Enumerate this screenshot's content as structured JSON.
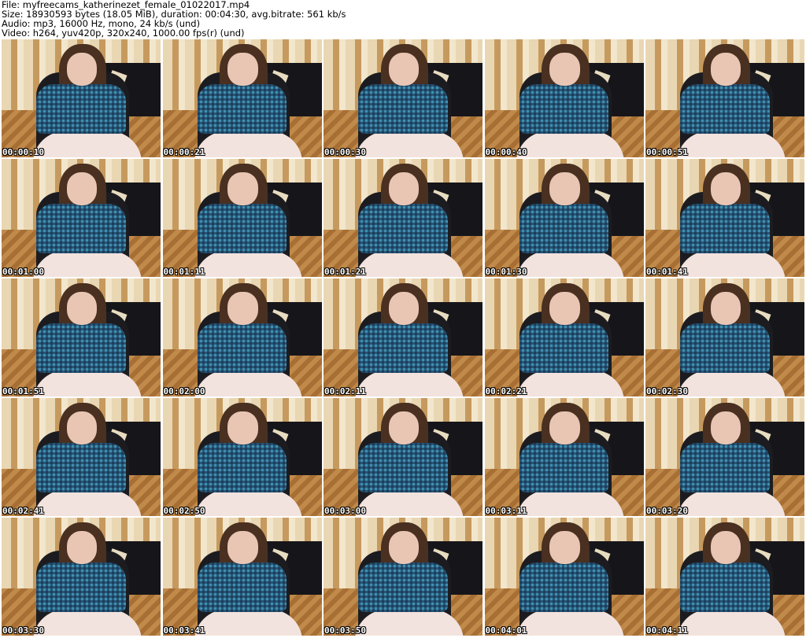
{
  "header": {
    "file_line": "File: myfreecams_katherinezet_female_01022017.mp4",
    "size_line": "Size: 18930593 bytes (18.05 MiB), duration: 00:04:30, avg.bitrate: 561 kb/s",
    "audio_line": "Audio: mp3, 16000 Hz, mono, 24 kb/s (und)",
    "video_line": "Video: h264, yuv420p, 320x240, 1000.00 fps(r) (und)"
  },
  "thumbnails": [
    "00:00:10",
    "00:00:21",
    "00:00:30",
    "00:00:40",
    "00:00:51",
    "00:01:00",
    "00:01:11",
    "00:01:21",
    "00:01:30",
    "00:01:41",
    "00:01:51",
    "00:02:00",
    "00:02:11",
    "00:02:21",
    "00:02:30",
    "00:02:41",
    "00:02:50",
    "00:03:00",
    "00:03:11",
    "00:03:20",
    "00:03:30",
    "00:03:41",
    "00:03:50",
    "00:04:01",
    "00:04:11"
  ]
}
